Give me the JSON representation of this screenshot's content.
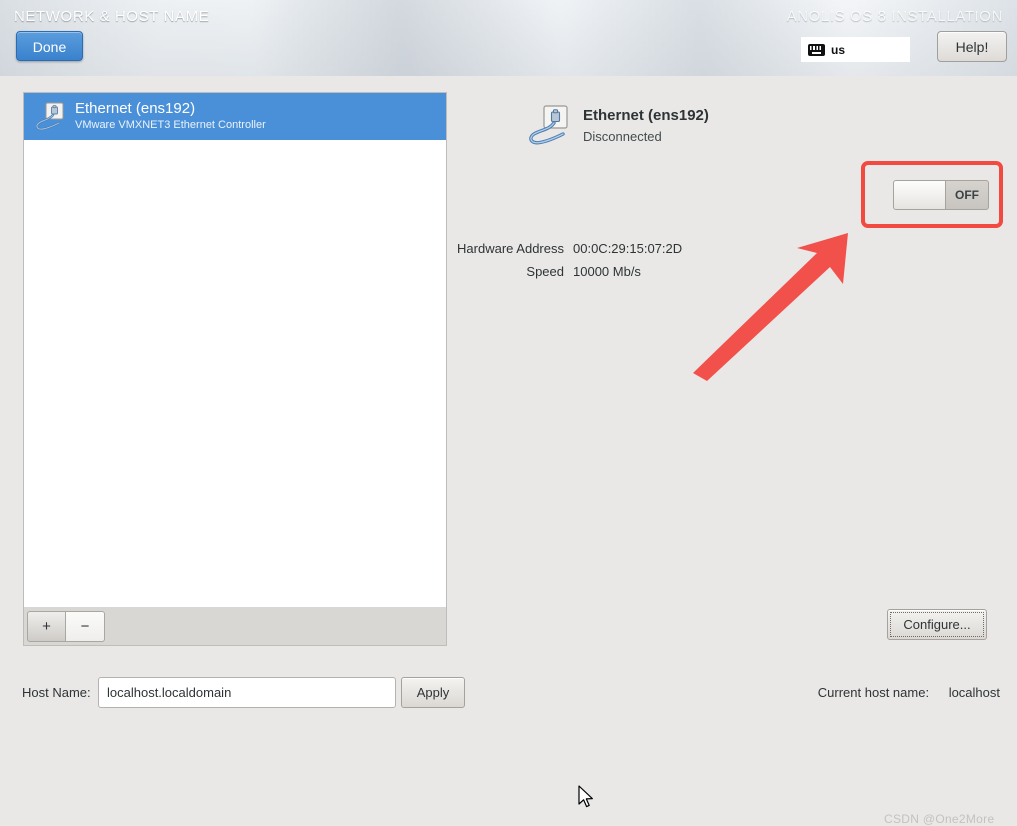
{
  "header": {
    "title": "NETWORK & HOST NAME",
    "product_title": "ANOLIS OS 8 INSTALLATION",
    "done_label": "Done",
    "help_label": "Help!",
    "keyboard_layout": "us",
    "keyboard_icon": "keyboard-icon"
  },
  "device_list": {
    "items": [
      {
        "name": "Ethernet (ens192)",
        "description": "VMware VMXNET3 Ethernet Controller",
        "icon": "ethernet-icon",
        "selected": true
      }
    ],
    "add_label": "+",
    "remove_label": "−"
  },
  "detail": {
    "icon": "ethernet-icon",
    "title": "Ethernet (ens192)",
    "status": "Disconnected",
    "fields": [
      {
        "label": "Hardware Address",
        "value": "00:0C:29:15:07:2D"
      },
      {
        "label": "Speed",
        "value": "10000 Mb/s"
      }
    ],
    "toggle": {
      "state_label": "OFF",
      "on": false
    },
    "configure_label": "Configure..."
  },
  "footer": {
    "hostname_label": "Host Name:",
    "hostname_value": "localhost.localdomain",
    "hostname_placeholder": "localhost.localdomain",
    "apply_label": "Apply",
    "current_host_label": "Current host name:",
    "current_host_value": "localhost"
  },
  "annotations": {
    "highlight_color": "#f24a41",
    "arrow_color": "#f2504a",
    "watermark": "CSDN @One2More"
  },
  "colors": {
    "selection_blue": "#4a90d9",
    "accent_blue": "#3a82cd",
    "background": "#e9e8e6"
  }
}
